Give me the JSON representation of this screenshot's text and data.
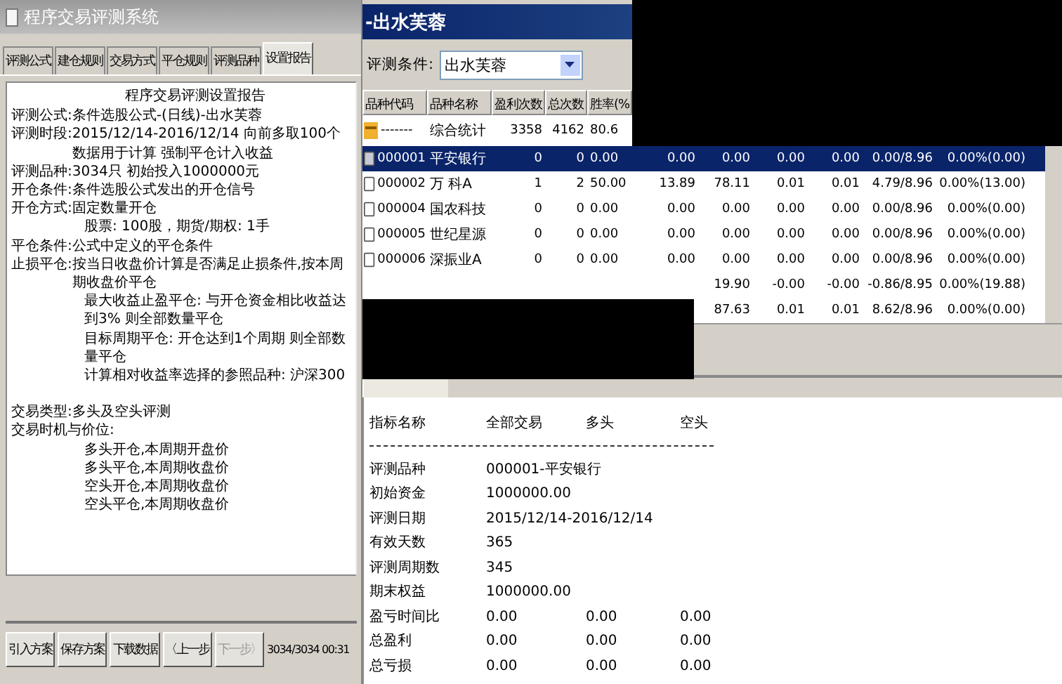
{
  "left_window": {
    "title": "程序交易评测系统",
    "tabs": [
      {
        "label": "评测公式",
        "selected": false
      },
      {
        "label": "建仓规则",
        "selected": false
      },
      {
        "label": "交易方式",
        "selected": false
      },
      {
        "label": "平仓规则",
        "selected": false
      },
      {
        "label": "评测品种",
        "selected": false
      },
      {
        "label": "设置报告",
        "selected": true
      }
    ],
    "report": {
      "title": "程序交易评测设置报告",
      "lines": [
        {
          "kind": "field",
          "label": "评测公式:",
          "text": "条件选股公式-(日线)-出水芙蓉"
        },
        {
          "kind": "field",
          "label": "评测时段:",
          "text": "2015/12/14-2016/12/14 向前多取100个数据用于计算 强制平仓计入收益"
        },
        {
          "kind": "field",
          "label": "评测品种:",
          "text": "3034只 初始投入1000000元"
        },
        {
          "kind": "field",
          "label": "开仓条件:",
          "text": "条件选股公式发出的开仓信号"
        },
        {
          "kind": "field",
          "label": "开仓方式:",
          "text": "固定数量开仓"
        },
        {
          "kind": "sub",
          "text": "股票: 100股，期货/期权: 1手"
        },
        {
          "kind": "field",
          "label": "平仓条件:",
          "text": "公式中定义的平仓条件"
        },
        {
          "kind": "field",
          "label": "止损平仓:",
          "text": "按当日收盘价计算是否满足止损条件,按本周期收盘价平仓"
        },
        {
          "kind": "sub",
          "text": "最大收益止盈平仓: 与开仓资金相比收益达到3% 则全部数量平仓"
        },
        {
          "kind": "sub",
          "text": "目标周期平仓: 开仓达到1个周期 则全部数量平仓"
        },
        {
          "kind": "sub",
          "text": "计算相对收益率选择的参照品种: 沪深300"
        },
        {
          "kind": "gap"
        },
        {
          "kind": "field",
          "label": "交易类型:",
          "text": "多头及空头评测"
        },
        {
          "kind": "field",
          "label": "交易时机与价位:"
        },
        {
          "kind": "sub",
          "text": "多头开仓,本周期开盘价"
        },
        {
          "kind": "sub",
          "text": "多头平仓,本周期收盘价"
        },
        {
          "kind": "sub",
          "text": "空头开仓,本周期收盘价"
        },
        {
          "kind": "sub",
          "text": "空头平仓,本周期收盘价"
        }
      ]
    },
    "buttons": [
      {
        "label": "引入方案",
        "disabled": false
      },
      {
        "label": "保存方案",
        "disabled": false
      },
      {
        "label": "下载数据",
        "disabled": false
      },
      {
        "label": "〈上一步",
        "disabled": false
      },
      {
        "label": "下一步〉",
        "disabled": true
      }
    ],
    "status": "3034/3034 00:31"
  },
  "right_window": {
    "title": "-出水芙蓉",
    "condition": {
      "label": "评测条件:",
      "value": "出水芙蓉"
    },
    "table": {
      "columns": [
        "品种代码",
        "品种名称",
        "盈利次数",
        "总次数",
        "胜率(%"
      ],
      "rows": [
        {
          "kind": "summary",
          "selected": false,
          "cells": [
            "-------",
            "综合统计",
            "3358",
            "4162",
            "80.6"
          ]
        },
        {
          "kind": "stock",
          "selected": true,
          "cells": [
            "000001",
            "平安银行",
            "0",
            "0",
            "0.00",
            "0.00",
            "0.00",
            "0.00",
            "0.00",
            "0.00/8.96",
            "0.00%(0.00)"
          ]
        },
        {
          "kind": "stock",
          "selected": false,
          "cells": [
            "000002",
            "万 科A",
            "1",
            "2",
            "50.00",
            "13.89",
            "78.11",
            "0.01",
            "0.01",
            "4.79/8.96",
            "0.00%(13.00)"
          ]
        },
        {
          "kind": "stock",
          "selected": false,
          "cells": [
            "000004",
            "国农科技",
            "0",
            "0",
            "0.00",
            "0.00",
            "0.00",
            "0.00",
            "0.00",
            "0.00/8.96",
            "0.00%(0.00)"
          ]
        },
        {
          "kind": "stock",
          "selected": false,
          "cells": [
            "000005",
            "世纪星源",
            "0",
            "0",
            "0.00",
            "0.00",
            "0.00",
            "0.00",
            "0.00",
            "0.00/8.96",
            "0.00%(0.00)"
          ]
        },
        {
          "kind": "stock",
          "selected": false,
          "cells": [
            "000006",
            "深振业A",
            "0",
            "0",
            "0.00",
            "0.00",
            "0.00",
            "0.00",
            "0.00",
            "0.00/8.96",
            "0.00%(0.00)"
          ]
        },
        {
          "kind": "stock",
          "selected": false,
          "cells": [
            null,
            null,
            null,
            null,
            null,
            null,
            "19.90",
            "-0.00",
            "-0.00",
            "-0.86/8.95",
            "0.00%(19.88)"
          ]
        },
        {
          "kind": "stock",
          "selected": false,
          "cells": [
            null,
            null,
            null,
            null,
            null,
            null,
            "87.63",
            "0.01",
            "0.01",
            "8.62/8.96",
            "0.00%(0.00)"
          ]
        }
      ]
    },
    "report": {
      "columns": [
        "指标名称",
        "全部交易",
        "多头",
        "空头"
      ],
      "rows": [
        {
          "cells": [
            "评测品种",
            "000001-平安银行"
          ]
        },
        {
          "cells": [
            "初始资金",
            "1000000.00"
          ]
        },
        {
          "cells": [
            "评测日期",
            "2015/12/14-2016/12/14"
          ]
        },
        {
          "cells": [
            "有效天数",
            "365"
          ]
        },
        {
          "cells": [
            "评测周期数",
            "345"
          ]
        },
        {
          "cells": [
            "期末权益",
            "1000000.00"
          ]
        },
        {
          "cells": [
            "盈亏时间比",
            "0.00",
            "0.00",
            "0.00"
          ]
        },
        {
          "cells": [
            "总盈利",
            "0.00",
            "0.00",
            "0.00"
          ]
        },
        {
          "cells": [
            "总亏损",
            "0.00",
            "0.00",
            "0.00"
          ]
        }
      ]
    }
  }
}
